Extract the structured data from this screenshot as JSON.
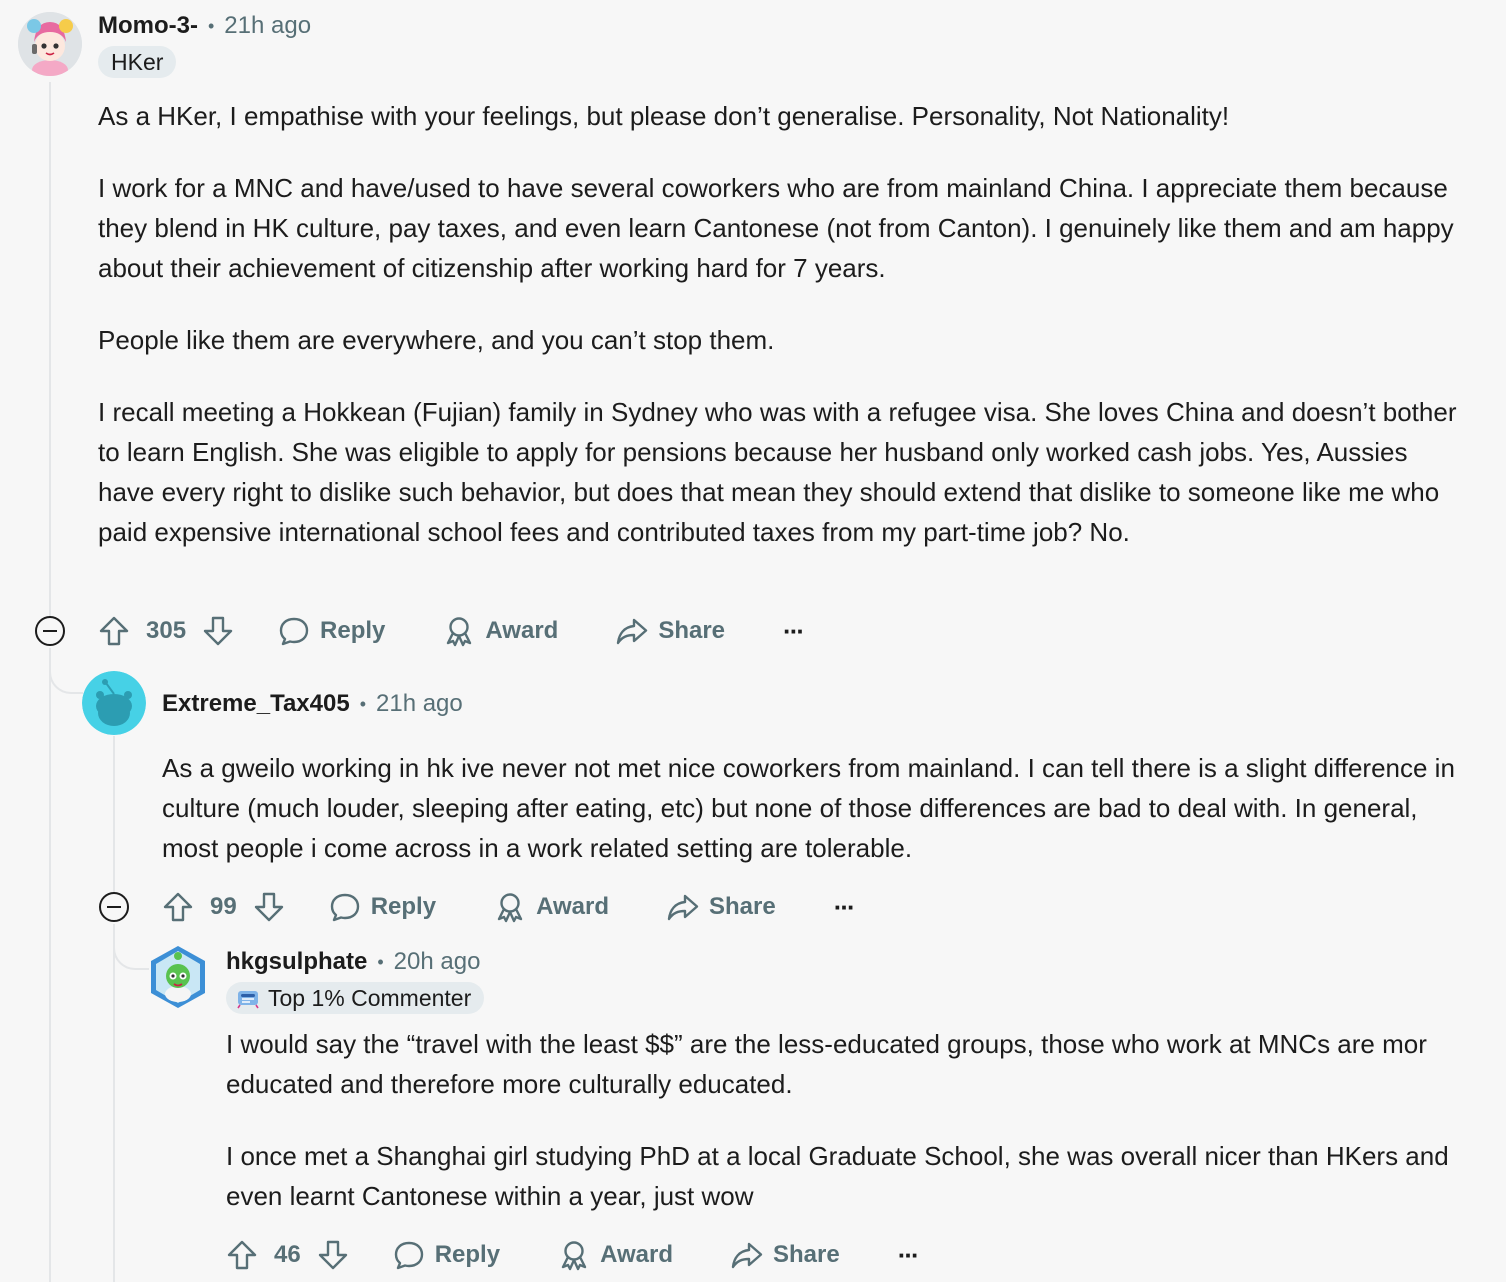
{
  "comments": [
    {
      "username": "Momo-3-",
      "separator": "•",
      "time": "21h ago",
      "flair": "HKer",
      "paragraphs": [
        "As a HKer, I empathise with your feelings, but please don’t generalise. Personality, Not Nationality!",
        "I work for a MNC and have/used to have several coworkers who are from mainland China. I appreciate them because they blend in HK culture, pay taxes, and even learn Cantonese (not from Canton). I genuinely like them and am happy about their achievement of citizenship after working hard for 7 years.",
        "People like them are everywhere, and you can’t stop them.",
        "I recall meeting a Hokkean (Fujian) family in Sydney who was with a refugee visa. She loves China and doesn’t bother to learn English. She was eligible to apply for pensions because her husband only worked cash jobs. Yes, Aussies have every right to dislike such behavior, but does that mean they should extend that dislike to someone like me who paid expensive international school fees and contributed taxes from my part-time job? No."
      ],
      "votes": "305",
      "reply_label": "Reply",
      "award_label": "Award",
      "share_label": "Share",
      "more_label": "···"
    },
    {
      "username": "Extreme_Tax405",
      "separator": "•",
      "time": "21h ago",
      "paragraphs": [
        "As a gweilo working in hk ive never not met nice coworkers from mainland. I can tell there is a slight difference in culture (much louder, sleeping after eating, etc) but none of those differences are bad to deal with. In general, most people i come across in a work related setting are tolerable."
      ],
      "votes": "99",
      "reply_label": "Reply",
      "award_label": "Award",
      "share_label": "Share",
      "more_label": "···"
    },
    {
      "username": "hkgsulphate",
      "separator": "•",
      "time": "20h ago",
      "flair": "Top 1% Commenter",
      "paragraphs": [
        "I would say the “travel with the least $$” are the less-educated groups, those who work at MNCs are mor educated and therefore more culturally educated.",
        "I once met a Shanghai girl studying PhD at a local Graduate School, she was overall nicer than HKers and even learnt Cantonese within a year, just wow"
      ],
      "votes": "46",
      "reply_label": "Reply",
      "award_label": "Award",
      "share_label": "Share",
      "more_label": "···"
    }
  ],
  "colors": {
    "background": "#f7f7f7",
    "text": "#1c1c1c",
    "muted": "#576f76",
    "flair_bg": "#e5ebee",
    "thread_line": "#e4e6e8"
  },
  "icons": [
    "upvote-icon",
    "downvote-icon",
    "reply-icon",
    "award-icon",
    "share-icon",
    "more-icon",
    "collapse-icon"
  ]
}
